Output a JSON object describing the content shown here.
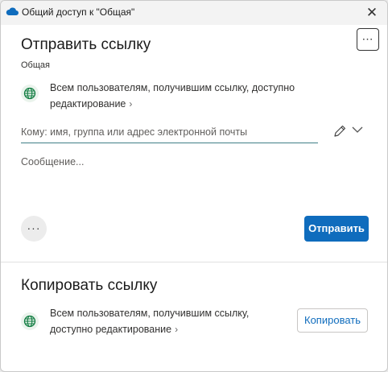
{
  "window": {
    "title": "Общий доступ к \"Общая\"",
    "close_glyph": "✕"
  },
  "more_glyph": "⋯",
  "send_section": {
    "heading": "Отправить ссылку",
    "subtitle": "Общая",
    "permission_line1": "Всем пользователям, получившим ссылку, доступно",
    "permission_line2": "редактирование",
    "to_placeholder": "Кому: имя, группа или адрес электронной почты",
    "message_placeholder": "Сообщение...",
    "options_glyph": "···",
    "send_label": "Отправить"
  },
  "copy_section": {
    "heading": "Копировать ссылку",
    "permission_line1": "Всем пользователям, получившим ссылку,",
    "permission_line2": "доступно редактирование",
    "copy_label": "Копировать"
  },
  "icons": {
    "title_icon": "cloud-icon",
    "globe": "globe-icon",
    "edit": "pencil-icon",
    "dropdown": "chevron-down-icon",
    "chevron": "›"
  },
  "colors": {
    "accent": "#0f6cbd",
    "globe": "#107c41",
    "input_underline": "#3f7f86"
  }
}
